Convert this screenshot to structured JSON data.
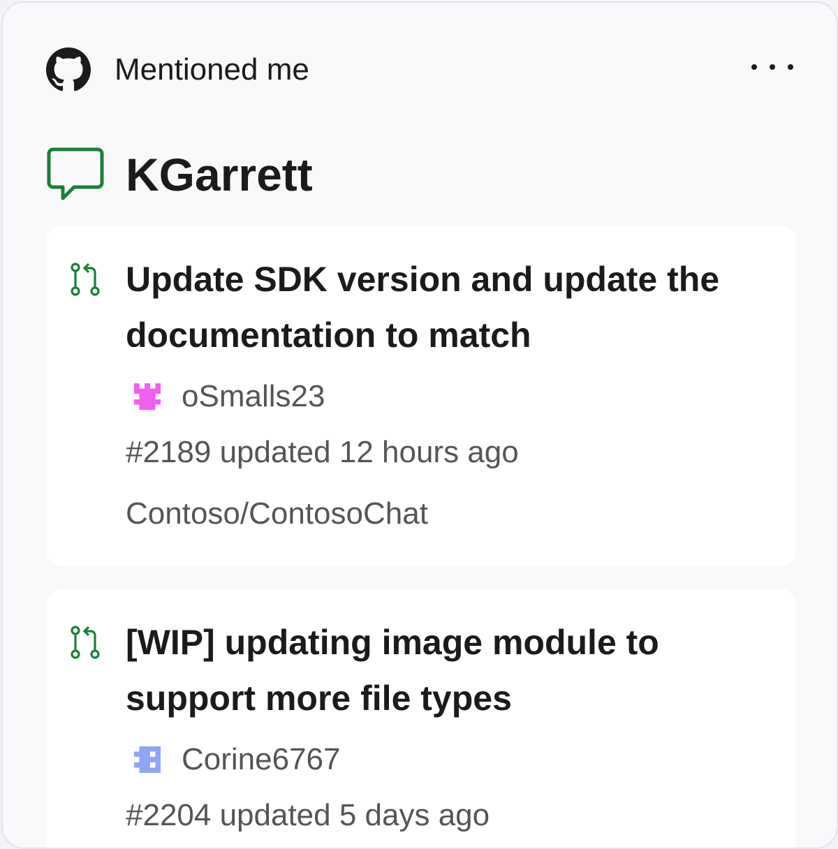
{
  "header": {
    "title": "Mentioned me",
    "icon": "github-icon",
    "menu_icon": "more-icon"
  },
  "user": {
    "icon": "comment-icon",
    "name": "KGarrett",
    "icon_color": "#1a7f37"
  },
  "items": [
    {
      "icon": "pull-request-icon",
      "title": "Update SDK version and update the documentation to match",
      "author": "oSmalls23",
      "avatar_icon": "identicon-avatar",
      "avatar_color": "#f25ef0",
      "updated": "#2189 updated 12 hours ago",
      "repo": "Contoso/ContosoChat"
    },
    {
      "icon": "pull-request-icon",
      "title": "[WIP] updating image module to support more file types",
      "author": "Corine6767",
      "avatar_icon": "identicon-avatar",
      "avatar_color": "#8fa6f5",
      "updated": "#2204 updated 5 days ago"
    }
  ]
}
